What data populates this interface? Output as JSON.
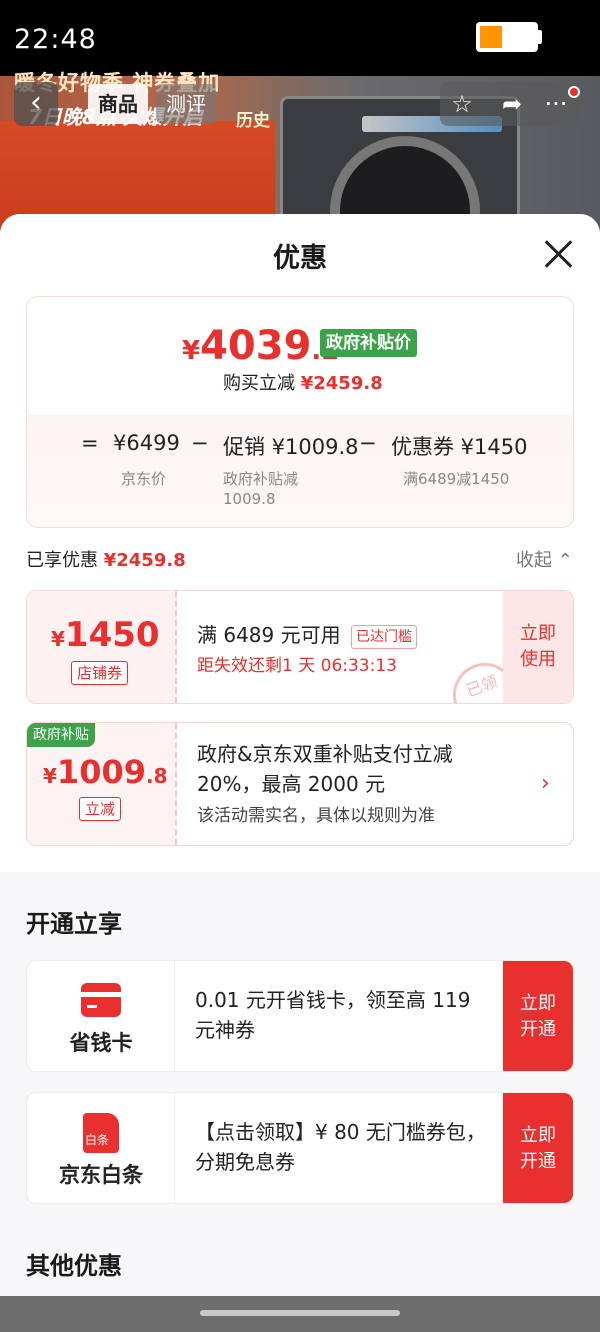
{
  "status": {
    "time": "22:48"
  },
  "product_bg": {
    "promo_line1": "暖冬好物季 神券叠加",
    "promo_line2": "7日晚8点 火爆开启",
    "promo_corner": "历史"
  },
  "nav": {
    "tabs": [
      {
        "label": "商品"
      },
      {
        "label": "测评"
      }
    ]
  },
  "sheet": {
    "title": "优惠",
    "price": {
      "symbol": "¥",
      "integer": "4039",
      "decimal": ".2",
      "gov_tag": "政府补贴价",
      "cut_label": "购买立减",
      "cut_value": "¥2459.8"
    },
    "formula": {
      "eq": "=",
      "jd_price": "¥6499",
      "jd_price_label": "京东价",
      "minus1": "−",
      "promo": "促销 ¥1009.8",
      "promo_label": "政府补贴减",
      "promo_label2": "1009.8",
      "minus2": "−",
      "coupon": "优惠券 ¥1450",
      "coupon_label": "满6489减1450"
    },
    "enjoyed": {
      "label": "已享优惠",
      "value": "¥2459.8",
      "collapse": "收起"
    },
    "coupon1": {
      "symbol": "¥",
      "amount": "1450",
      "tag": "店铺券",
      "main": "满 6489 元可用",
      "badge": "已达门槛",
      "sub": "距失效还剩1 天 06:33:13",
      "action_line1": "立即",
      "action_line2": "使用",
      "stamp": "已领"
    },
    "coupon2": {
      "corner": "政府补贴",
      "symbol": "¥",
      "amount": "1009",
      "decimal": ".8",
      "tag": "立减",
      "main_line1": "政府&京东双重补贴支付立减",
      "main_line2": "20%，最高 2000 元",
      "sub": "该活动需实名，具体以规则为准"
    },
    "open_section": {
      "title": "开通立享",
      "items": [
        {
          "name": "省钱卡",
          "desc": "0.01 元开省钱卡，领至高 119 元神券",
          "action_line1": "立即",
          "action_line2": "开通"
        },
        {
          "name": "京东白条",
          "icon_text": "白条",
          "desc": "【点击领取】¥ 80 无门槛券包，分期免息券",
          "action_line1": "立即",
          "action_line2": "开通"
        }
      ]
    },
    "other_title": "其他优惠"
  },
  "icons": {
    "back": "chevron-left-icon",
    "star": "star-icon",
    "share": "share-icon",
    "more": "more-icon",
    "close": "close-icon",
    "collapse": "chevron-up-icon",
    "arrow": "chevron-right-icon"
  },
  "colors": {
    "accent_red": "#e8302e",
    "gov_green": "#3ca24b"
  }
}
